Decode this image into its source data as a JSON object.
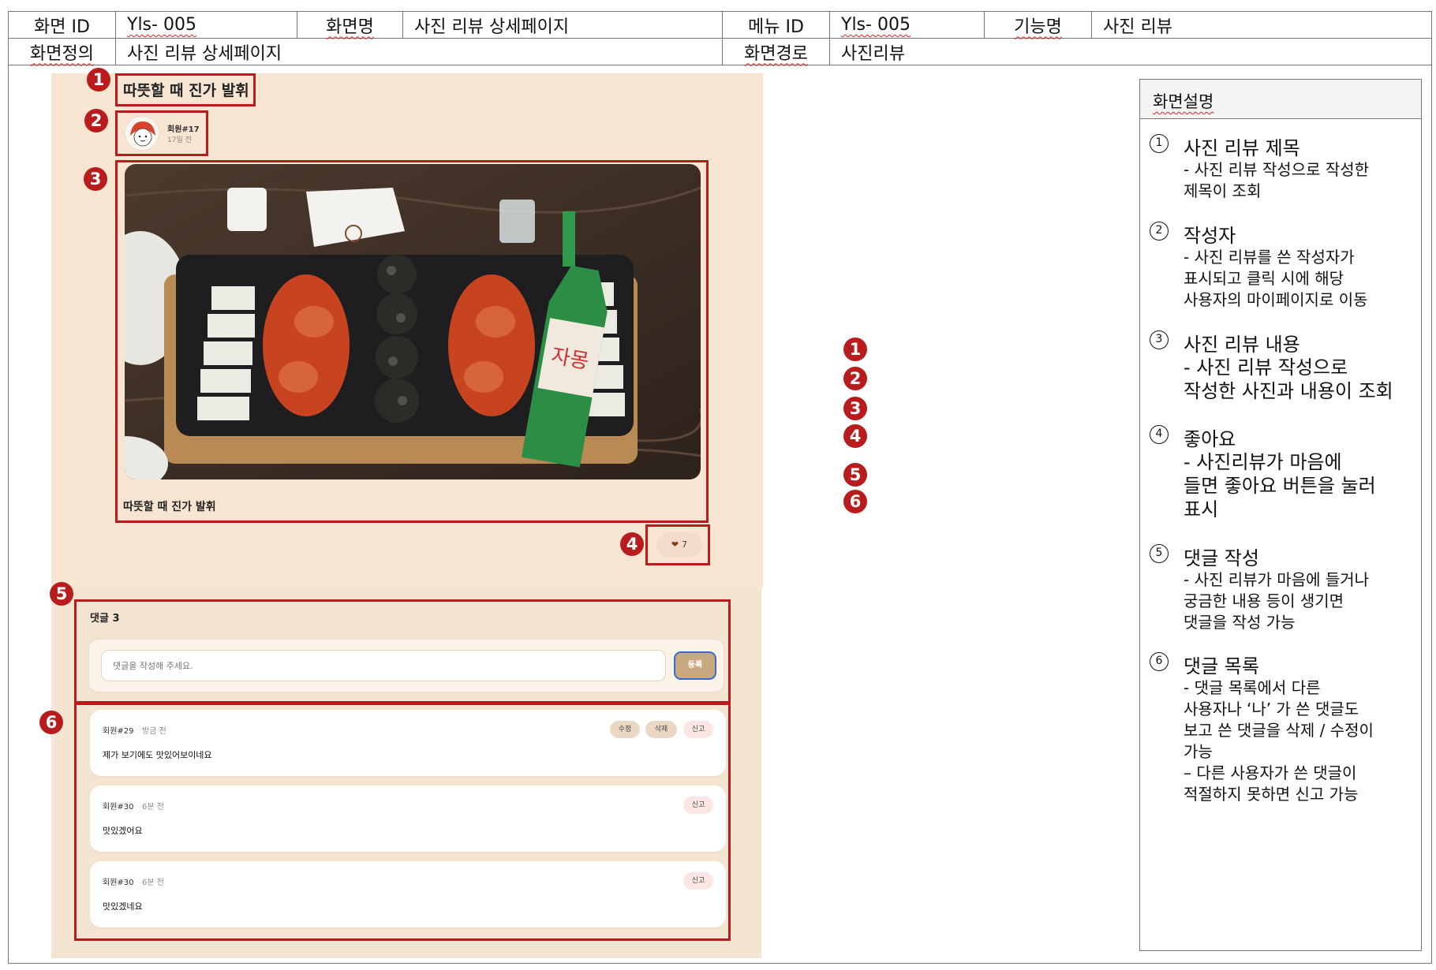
{
  "header": {
    "screen_id_label": "화면 ID",
    "screen_id_value": "Yls- 005",
    "screen_name_label": "화면명",
    "screen_name_value": "사진 리뷰 상세페이지",
    "menu_id_label": "메뉴 ID",
    "menu_id_value": "Yls- 005",
    "function_label": "기능명",
    "function_value": "사진 리뷰",
    "definition_label": "화면정의",
    "definition_value": "사진 리뷰 상세페이지",
    "path_label": "화면경로",
    "path_value": "사진리뷰"
  },
  "markers": [
    "1",
    "2",
    "3",
    "4",
    "5",
    "6"
  ],
  "review": {
    "title": "따뜻할 때 진가 발휘",
    "author": "회원#17",
    "time": "17일 전",
    "caption": "따뜻할 때 진가 발휘",
    "like_count": "7"
  },
  "comments": {
    "count_label": "댓글 3",
    "placeholder": "댓글을 작성해 주세요.",
    "submit_label": "등록",
    "items": [
      {
        "author": "회원#29",
        "time": "방금 전",
        "text": "제가 보기에도 맛있어보이네요",
        "edit": "수정",
        "delete": "삭제",
        "report": "신고"
      },
      {
        "author": "회원#30",
        "time": "6분 전",
        "text": "맛있겠어요",
        "report": "신고"
      },
      {
        "author": "회원#30",
        "time": "6분 전",
        "text": "맛있겠네요",
        "report": "신고"
      }
    ]
  },
  "description": {
    "heading": "화면설명",
    "items": [
      {
        "num": "1",
        "title": "사진 리뷰 제목",
        "body": "- 사진 리뷰 작성으로 작성한\n  제목이 조회"
      },
      {
        "num": "2",
        "title": "작성자",
        "body": "- 사진 리뷰를 쓴 작성자가\n표시되고 클릭 시에 해당\n사용자의 마이페이지로 이동"
      },
      {
        "num": "3",
        "title": "사진 리뷰 내용",
        "body": "- 사진 리뷰 작성으로\n작성한 사진과 내용이 조회"
      },
      {
        "num": "4",
        "title": "좋아요",
        "body": "- 사진리뷰가 마음에\n  들면 좋아요 버튼을 눌러\n  표시"
      },
      {
        "num": "5",
        "title": "댓글 작성",
        "body": "- 사진 리뷰가 마음에 들거나\n궁금한 내용 등이 생기면\n댓글을 작성 가능"
      },
      {
        "num": "6",
        "title": "댓글 목록",
        "body": "- 댓글 목록에서 다른\n사용자나 ‘나’ 가 쓴 댓글도\n보고 쓴 댓글을 삭제 / 수정이\n가능\n– 다른 사용자가 쓴 댓글이\n적절하지 못하면 신고 가능"
      }
    ]
  },
  "colors": {
    "marker_red": "#b81c1c",
    "page_bg": "#f7e5d1",
    "submit_button": "#c9a97f"
  }
}
